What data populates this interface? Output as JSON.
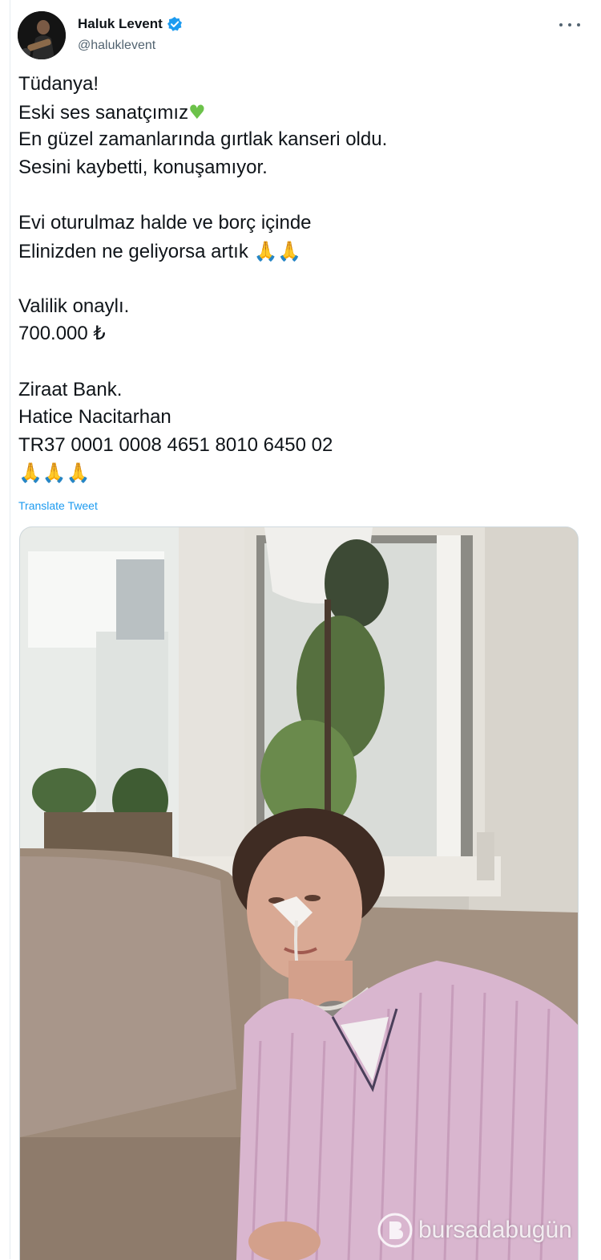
{
  "author": {
    "name": "Haluk Levent",
    "handle": "@haluklevent"
  },
  "icons": {
    "verified": "verified-badge-icon",
    "more": "more-options-icon",
    "heart": "green-heart-emoji",
    "pray": "folded-hands-emoji"
  },
  "colors": {
    "link": "#1d9bf0",
    "text": "#0f1419",
    "secondary": "#536471",
    "heart": "#6cc24a"
  },
  "tweet": {
    "line1": "Tüdanya!",
    "line2": "Eski ses sanatçımız",
    "line3": "En güzel zamanlarında gırtlak kanseri oldu.",
    "line4": "Sesini kaybetti, konuşamıyor.",
    "line5": "Evi oturulmaz halde ve borç içinde",
    "line6": "Elinizden ne geliyorsa artık",
    "line7": "Valilik onaylı.",
    "line8": "700.000 ₺",
    "line9": "Ziraat Bank.",
    "line10": "Hatice Nacitarhan",
    "line11": "TR37 0001 0008 4651 8010 6450 02"
  },
  "translate_label": "Translate Tweet",
  "watermark": "bursadabugün"
}
